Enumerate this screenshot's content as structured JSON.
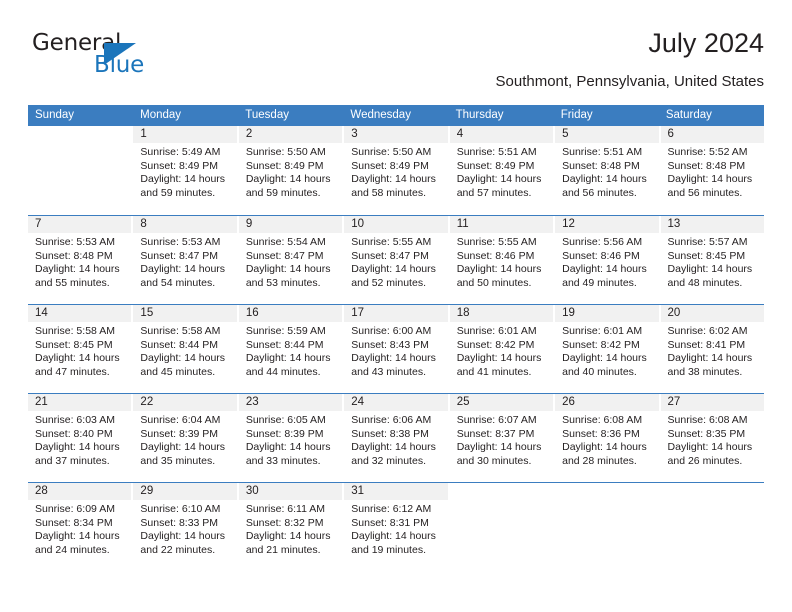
{
  "logo": {
    "word1": "General",
    "word2": "Blue",
    "accent_color": "#1b75bb"
  },
  "header": {
    "title": "July 2024",
    "location": "Southmont, Pennsylvania, United States"
  },
  "calendar": {
    "header_color": "#3b7dc0",
    "weekdays": [
      "Sunday",
      "Monday",
      "Tuesday",
      "Wednesday",
      "Thursday",
      "Friday",
      "Saturday"
    ],
    "weeks": [
      [
        {
          "empty": true
        },
        {
          "day": "1",
          "sunrise": "Sunrise: 5:49 AM",
          "sunset": "Sunset: 8:49 PM",
          "daylight1": "Daylight: 14 hours",
          "daylight2": "and 59 minutes."
        },
        {
          "day": "2",
          "sunrise": "Sunrise: 5:50 AM",
          "sunset": "Sunset: 8:49 PM",
          "daylight1": "Daylight: 14 hours",
          "daylight2": "and 59 minutes."
        },
        {
          "day": "3",
          "sunrise": "Sunrise: 5:50 AM",
          "sunset": "Sunset: 8:49 PM",
          "daylight1": "Daylight: 14 hours",
          "daylight2": "and 58 minutes."
        },
        {
          "day": "4",
          "sunrise": "Sunrise: 5:51 AM",
          "sunset": "Sunset: 8:49 PM",
          "daylight1": "Daylight: 14 hours",
          "daylight2": "and 57 minutes."
        },
        {
          "day": "5",
          "sunrise": "Sunrise: 5:51 AM",
          "sunset": "Sunset: 8:48 PM",
          "daylight1": "Daylight: 14 hours",
          "daylight2": "and 56 minutes."
        },
        {
          "day": "6",
          "sunrise": "Sunrise: 5:52 AM",
          "sunset": "Sunset: 8:48 PM",
          "daylight1": "Daylight: 14 hours",
          "daylight2": "and 56 minutes."
        }
      ],
      [
        {
          "day": "7",
          "sunrise": "Sunrise: 5:53 AM",
          "sunset": "Sunset: 8:48 PM",
          "daylight1": "Daylight: 14 hours",
          "daylight2": "and 55 minutes."
        },
        {
          "day": "8",
          "sunrise": "Sunrise: 5:53 AM",
          "sunset": "Sunset: 8:47 PM",
          "daylight1": "Daylight: 14 hours",
          "daylight2": "and 54 minutes."
        },
        {
          "day": "9",
          "sunrise": "Sunrise: 5:54 AM",
          "sunset": "Sunset: 8:47 PM",
          "daylight1": "Daylight: 14 hours",
          "daylight2": "and 53 minutes."
        },
        {
          "day": "10",
          "sunrise": "Sunrise: 5:55 AM",
          "sunset": "Sunset: 8:47 PM",
          "daylight1": "Daylight: 14 hours",
          "daylight2": "and 52 minutes."
        },
        {
          "day": "11",
          "sunrise": "Sunrise: 5:55 AM",
          "sunset": "Sunset: 8:46 PM",
          "daylight1": "Daylight: 14 hours",
          "daylight2": "and 50 minutes."
        },
        {
          "day": "12",
          "sunrise": "Sunrise: 5:56 AM",
          "sunset": "Sunset: 8:46 PM",
          "daylight1": "Daylight: 14 hours",
          "daylight2": "and 49 minutes."
        },
        {
          "day": "13",
          "sunrise": "Sunrise: 5:57 AM",
          "sunset": "Sunset: 8:45 PM",
          "daylight1": "Daylight: 14 hours",
          "daylight2": "and 48 minutes."
        }
      ],
      [
        {
          "day": "14",
          "sunrise": "Sunrise: 5:58 AM",
          "sunset": "Sunset: 8:45 PM",
          "daylight1": "Daylight: 14 hours",
          "daylight2": "and 47 minutes."
        },
        {
          "day": "15",
          "sunrise": "Sunrise: 5:58 AM",
          "sunset": "Sunset: 8:44 PM",
          "daylight1": "Daylight: 14 hours",
          "daylight2": "and 45 minutes."
        },
        {
          "day": "16",
          "sunrise": "Sunrise: 5:59 AM",
          "sunset": "Sunset: 8:44 PM",
          "daylight1": "Daylight: 14 hours",
          "daylight2": "and 44 minutes."
        },
        {
          "day": "17",
          "sunrise": "Sunrise: 6:00 AM",
          "sunset": "Sunset: 8:43 PM",
          "daylight1": "Daylight: 14 hours",
          "daylight2": "and 43 minutes."
        },
        {
          "day": "18",
          "sunrise": "Sunrise: 6:01 AM",
          "sunset": "Sunset: 8:42 PM",
          "daylight1": "Daylight: 14 hours",
          "daylight2": "and 41 minutes."
        },
        {
          "day": "19",
          "sunrise": "Sunrise: 6:01 AM",
          "sunset": "Sunset: 8:42 PM",
          "daylight1": "Daylight: 14 hours",
          "daylight2": "and 40 minutes."
        },
        {
          "day": "20",
          "sunrise": "Sunrise: 6:02 AM",
          "sunset": "Sunset: 8:41 PM",
          "daylight1": "Daylight: 14 hours",
          "daylight2": "and 38 minutes."
        }
      ],
      [
        {
          "day": "21",
          "sunrise": "Sunrise: 6:03 AM",
          "sunset": "Sunset: 8:40 PM",
          "daylight1": "Daylight: 14 hours",
          "daylight2": "and 37 minutes."
        },
        {
          "day": "22",
          "sunrise": "Sunrise: 6:04 AM",
          "sunset": "Sunset: 8:39 PM",
          "daylight1": "Daylight: 14 hours",
          "daylight2": "and 35 minutes."
        },
        {
          "day": "23",
          "sunrise": "Sunrise: 6:05 AM",
          "sunset": "Sunset: 8:39 PM",
          "daylight1": "Daylight: 14 hours",
          "daylight2": "and 33 minutes."
        },
        {
          "day": "24",
          "sunrise": "Sunrise: 6:06 AM",
          "sunset": "Sunset: 8:38 PM",
          "daylight1": "Daylight: 14 hours",
          "daylight2": "and 32 minutes."
        },
        {
          "day": "25",
          "sunrise": "Sunrise: 6:07 AM",
          "sunset": "Sunset: 8:37 PM",
          "daylight1": "Daylight: 14 hours",
          "daylight2": "and 30 minutes."
        },
        {
          "day": "26",
          "sunrise": "Sunrise: 6:08 AM",
          "sunset": "Sunset: 8:36 PM",
          "daylight1": "Daylight: 14 hours",
          "daylight2": "and 28 minutes."
        },
        {
          "day": "27",
          "sunrise": "Sunrise: 6:08 AM",
          "sunset": "Sunset: 8:35 PM",
          "daylight1": "Daylight: 14 hours",
          "daylight2": "and 26 minutes."
        }
      ],
      [
        {
          "day": "28",
          "sunrise": "Sunrise: 6:09 AM",
          "sunset": "Sunset: 8:34 PM",
          "daylight1": "Daylight: 14 hours",
          "daylight2": "and 24 minutes."
        },
        {
          "day": "29",
          "sunrise": "Sunrise: 6:10 AM",
          "sunset": "Sunset: 8:33 PM",
          "daylight1": "Daylight: 14 hours",
          "daylight2": "and 22 minutes."
        },
        {
          "day": "30",
          "sunrise": "Sunrise: 6:11 AM",
          "sunset": "Sunset: 8:32 PM",
          "daylight1": "Daylight: 14 hours",
          "daylight2": "and 21 minutes."
        },
        {
          "day": "31",
          "sunrise": "Sunrise: 6:12 AM",
          "sunset": "Sunset: 8:31 PM",
          "daylight1": "Daylight: 14 hours",
          "daylight2": "and 19 minutes."
        },
        {
          "empty": true
        },
        {
          "empty": true
        },
        {
          "empty": true
        }
      ]
    ]
  }
}
